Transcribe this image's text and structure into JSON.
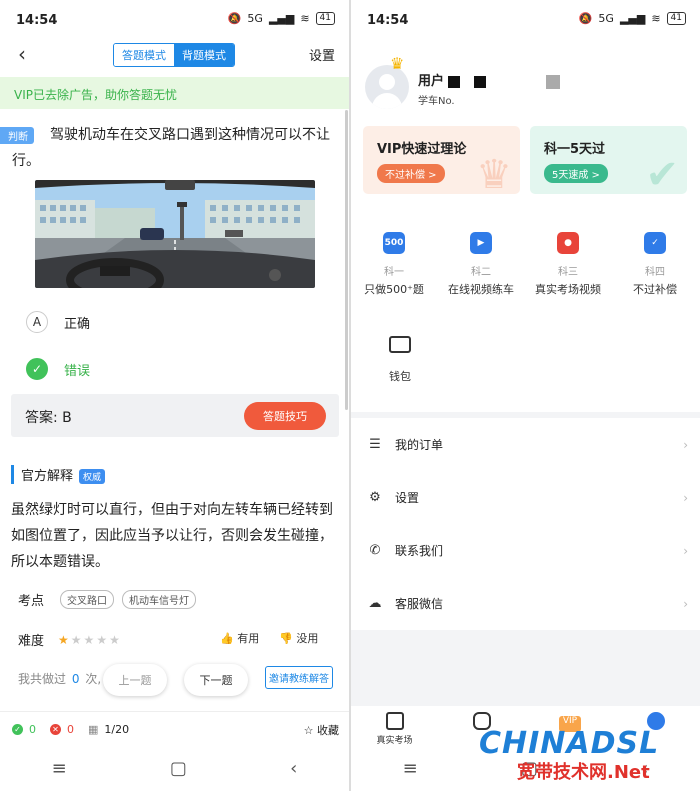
{
  "status": {
    "time": "14:54",
    "network": "5G",
    "battery": "41"
  },
  "left": {
    "modes": [
      "答题模式",
      "背题模式"
    ],
    "settings": "设置",
    "vip_banner": "VIP已去除广告，助你答题无忧",
    "question_type": "判断",
    "question": "驾驶机动车在交叉路口遇到这种情况可以不让行。",
    "options": [
      {
        "key": "A",
        "text": "正确"
      },
      {
        "key": "✓",
        "text": "错误"
      }
    ],
    "answer": "答案: B",
    "tip_button": "答题技巧",
    "section_title": "官方解释",
    "section_badge": "权威",
    "explanation": "虽然绿灯时可以直行，但由于对向左转车辆已经转到如图位置了，因此应当予以让行，否则会发生碰撞，所以本题错误。",
    "keypoint_label": "考点",
    "keypoint_tags": [
      "交叉路口",
      "机动车信号灯"
    ],
    "difficulty_label": "难度",
    "difficulty_stars": 1,
    "useful": "有用",
    "useless": "没用",
    "done_prefix": "我共做过",
    "done_count": "0",
    "done_suffix": "次,",
    "prev": "上一题",
    "next": "下一题",
    "invite": "邀请教练解答",
    "correct_count": "0",
    "wrong_count": "0",
    "progress": "1/20",
    "favorite": "收藏"
  },
  "right": {
    "username": "用户",
    "user_sub": "学车No.",
    "card1": {
      "title": "VIP快速过理论",
      "button": "不过补偿 >"
    },
    "card2": {
      "title": "科一5天过",
      "button": "5天速成 >"
    },
    "features": [
      {
        "icon": "500",
        "k": "科一",
        "d": "只做500⁺题",
        "color": "#2f7be8"
      },
      {
        "icon": "▶",
        "k": "科二",
        "d": "在线视频练车",
        "color": "#2f7be8"
      },
      {
        "icon": "●",
        "k": "科三",
        "d": "真实考场视频",
        "color": "#e8443a"
      },
      {
        "icon": "✓",
        "k": "科四",
        "d": "不过补偿",
        "color": "#2f7be8"
      }
    ],
    "wallet": "钱包",
    "menu": [
      "我的订单",
      "设置",
      "联系我们",
      "客服微信"
    ],
    "tabs": [
      "真实考场",
      "",
      "",
      ""
    ],
    "vip_tab": "VIP"
  },
  "watermark": {
    "brand": "CHINADSL",
    "sub": "宽带技术网.Net"
  }
}
